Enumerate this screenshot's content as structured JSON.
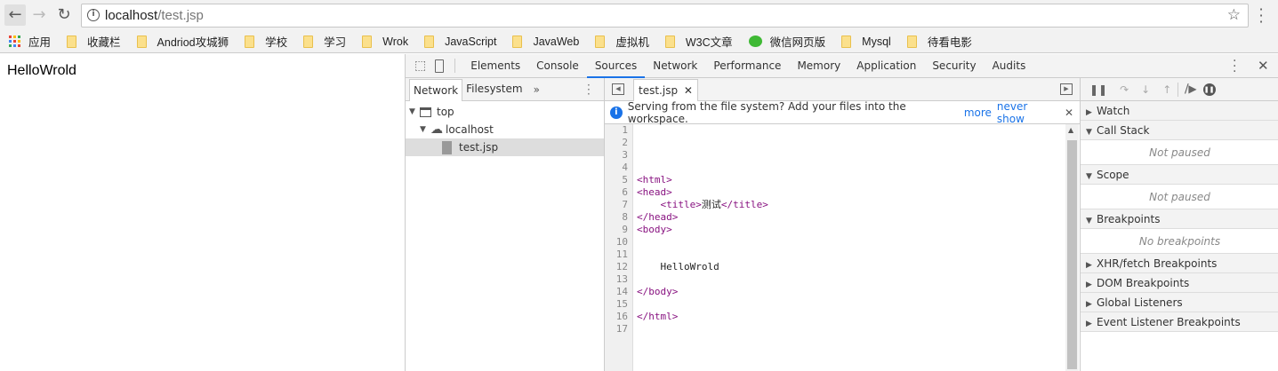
{
  "browser": {
    "url_host": "localhost",
    "url_path": "/test.jsp"
  },
  "bookmarks": [
    {
      "label": "应用",
      "icon": "apps-icon"
    },
    {
      "label": "收藏栏",
      "icon": "folder-icon"
    },
    {
      "label": "Andriod攻城狮",
      "icon": "folder-icon"
    },
    {
      "label": "学校",
      "icon": "folder-icon"
    },
    {
      "label": "学习",
      "icon": "folder-icon"
    },
    {
      "label": "Wrok",
      "icon": "folder-icon"
    },
    {
      "label": "JavaScript",
      "icon": "folder-icon"
    },
    {
      "label": "JavaWeb",
      "icon": "folder-icon"
    },
    {
      "label": "虚拟机",
      "icon": "folder-icon"
    },
    {
      "label": "W3C文章",
      "icon": "folder-icon"
    },
    {
      "label": "微信网页版",
      "icon": "wechat-icon"
    },
    {
      "label": "Mysql",
      "icon": "folder-icon"
    },
    {
      "label": "待看电影",
      "icon": "folder-icon"
    }
  ],
  "page": {
    "text": "HelloWrold"
  },
  "devtools": {
    "tabs": [
      "Elements",
      "Console",
      "Sources",
      "Network",
      "Performance",
      "Memory",
      "Application",
      "Security",
      "Audits"
    ],
    "active_tab": "Sources",
    "navigator": {
      "tabs": [
        "Network",
        "Filesystem"
      ],
      "tree": [
        "top",
        "localhost",
        "test.jsp"
      ]
    },
    "editor": {
      "file_tab": "test.jsp",
      "info": "Serving from the file system? Add your files into the workspace.",
      "more": "more",
      "never_show": "never show",
      "lines": [
        "",
        "",
        "",
        "",
        "<html>",
        "<head>",
        "    <title>测试</title>",
        "</head>",
        "<body>",
        "",
        "",
        "    HelloWrold",
        "",
        "</body>",
        "",
        "</html>",
        ""
      ]
    },
    "debugger": {
      "sections": [
        {
          "title": "Watch",
          "open": false
        },
        {
          "title": "Call Stack",
          "open": true,
          "empty": "Not paused"
        },
        {
          "title": "Scope",
          "open": true,
          "empty": "Not paused"
        },
        {
          "title": "Breakpoints",
          "open": true,
          "empty": "No breakpoints"
        },
        {
          "title": "XHR/fetch Breakpoints",
          "open": false
        },
        {
          "title": "DOM Breakpoints",
          "open": false
        },
        {
          "title": "Global Listeners",
          "open": false
        },
        {
          "title": "Event Listener Breakpoints",
          "open": false
        }
      ]
    }
  }
}
